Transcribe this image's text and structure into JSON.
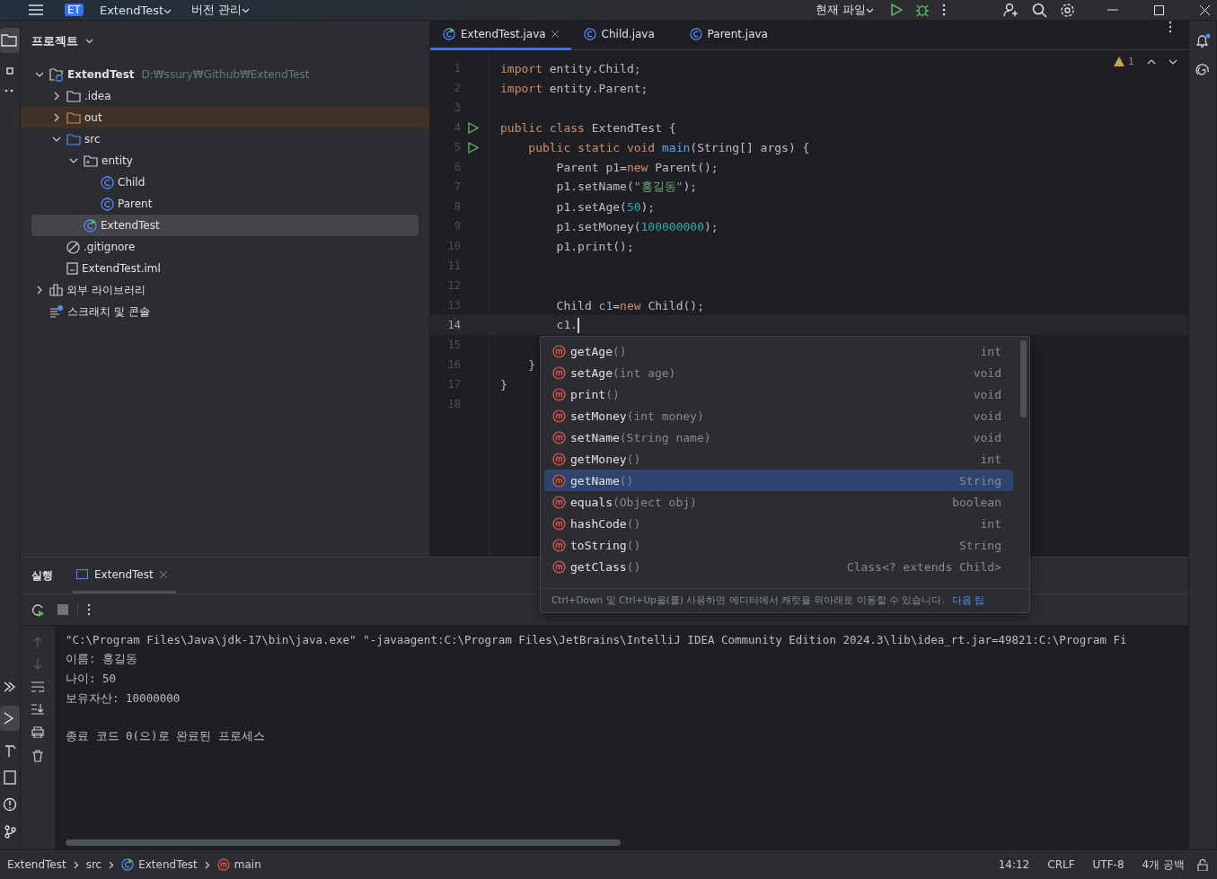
{
  "title_bar": {
    "project_badge": "ET",
    "project": "ExtendTest",
    "vcs": "버전 관리",
    "run_config": "현재 파일"
  },
  "project_panel": {
    "title": "프로젝트",
    "tree": [
      {
        "label": "ExtendTest",
        "path": "D:₩ssury₩Github₩ExtendTest",
        "kind": "project",
        "expanded": true,
        "selected": false,
        "children": [
          {
            "label": ".idea",
            "kind": "folder",
            "expanded": false,
            "selected": false
          },
          {
            "label": "out",
            "kind": "excluded",
            "expanded": false,
            "selected": false
          },
          {
            "label": "src",
            "kind": "source",
            "expanded": true,
            "selected": false,
            "children": [
              {
                "label": "entity",
                "kind": "package",
                "expanded": true,
                "selected": false,
                "children": [
                  {
                    "label": "Child",
                    "kind": "class",
                    "selected": false
                  },
                  {
                    "label": "Parent",
                    "kind": "class",
                    "selected": false
                  }
                ]
              },
              {
                "label": "ExtendTest",
                "kind": "main-class",
                "selected": true
              }
            ]
          },
          {
            "label": ".gitignore",
            "kind": "ignore",
            "selected": false
          },
          {
            "label": "ExtendTest.iml",
            "kind": "module-file",
            "selected": false
          }
        ]
      },
      {
        "label": "외부 라이브러리",
        "kind": "library",
        "expanded": false,
        "selected": false
      },
      {
        "label": "스크래치 및 콘솔",
        "kind": "scratch",
        "selected": false
      }
    ]
  },
  "editor": {
    "tabs": [
      {
        "label": "ExtendTest.java",
        "kind": "main-class",
        "selected": true,
        "closable": true
      },
      {
        "label": "Child.java",
        "kind": "class",
        "selected": false,
        "closable": false
      },
      {
        "label": "Parent.java",
        "kind": "class",
        "selected": false,
        "closable": false
      }
    ],
    "warnings": "1",
    "lines": [
      {
        "no": "1",
        "run": false,
        "current": false,
        "tokens": [
          {
            "t": "import ",
            "kind": "keyword"
          },
          {
            "t": "entity.Child;",
            "kind": "plain"
          }
        ]
      },
      {
        "no": "2",
        "run": false,
        "current": false,
        "tokens": [
          {
            "t": "import ",
            "kind": "keyword"
          },
          {
            "t": "entity.Parent;",
            "kind": "plain"
          }
        ]
      },
      {
        "no": "3",
        "run": false,
        "current": false
      },
      {
        "no": "4",
        "run": true,
        "current": false,
        "tokens": [
          {
            "t": "public class ",
            "kind": "keyword"
          },
          {
            "t": "ExtendTest {",
            "kind": "plain"
          }
        ]
      },
      {
        "no": "5",
        "run": true,
        "current": false,
        "tokens": [
          {
            "t": "    public static void ",
            "kind": "keyword"
          },
          {
            "t": "main",
            "kind": "function"
          },
          {
            "t": "(String[] args) {",
            "kind": "plain"
          }
        ]
      },
      {
        "no": "6",
        "run": false,
        "current": false,
        "tokens": [
          {
            "t": "        Parent p1=",
            "kind": "plain"
          },
          {
            "t": "new ",
            "kind": "keyword"
          },
          {
            "t": "Parent();",
            "kind": "plain"
          }
        ]
      },
      {
        "no": "7",
        "run": false,
        "current": false,
        "tokens": [
          {
            "t": "        p1.setName(",
            "kind": "plain"
          },
          {
            "t": "\"홍길동\"",
            "kind": "string"
          },
          {
            "t": ");",
            "kind": "plain"
          }
        ]
      },
      {
        "no": "8",
        "run": false,
        "current": false,
        "tokens": [
          {
            "t": "        p1.setAge(",
            "kind": "plain"
          },
          {
            "t": "50",
            "kind": "number"
          },
          {
            "t": ");",
            "kind": "plain"
          }
        ]
      },
      {
        "no": "9",
        "run": false,
        "current": false,
        "tokens": [
          {
            "t": "        p1.setMoney(",
            "kind": "plain"
          },
          {
            "t": "100000000",
            "kind": "number"
          },
          {
            "t": ");",
            "kind": "plain"
          }
        ]
      },
      {
        "no": "10",
        "run": false,
        "current": false,
        "tokens": [
          {
            "t": "        p1.print();",
            "kind": "plain"
          }
        ]
      },
      {
        "no": "11",
        "run": false,
        "current": false
      },
      {
        "no": "12",
        "run": false,
        "current": false
      },
      {
        "no": "13",
        "run": false,
        "current": false,
        "tokens": [
          {
            "t": "        Child ",
            "kind": "plain"
          },
          {
            "t": "c1",
            "kind": "variable"
          },
          {
            "t": "=",
            "kind": "plain"
          },
          {
            "t": "new ",
            "kind": "keyword"
          },
          {
            "t": "Child();",
            "kind": "plain"
          }
        ]
      },
      {
        "no": "14",
        "run": false,
        "current": true,
        "tokens": [
          {
            "t": "        c1.",
            "kind": "plain"
          }
        ]
      },
      {
        "no": "15",
        "run": false,
        "current": false
      },
      {
        "no": "16",
        "run": false,
        "current": false,
        "tokens": [
          {
            "t": "    }",
            "kind": "plain"
          }
        ]
      },
      {
        "no": "17",
        "run": false,
        "current": false,
        "tokens": [
          {
            "t": "}",
            "kind": "plain"
          }
        ]
      },
      {
        "no": "18",
        "run": false,
        "current": false
      }
    ]
  },
  "completion": {
    "items": [
      {
        "name": "getAge",
        "params": "()",
        "type": "int",
        "selected": false
      },
      {
        "name": "setAge",
        "params": "(int age)",
        "type": "void",
        "selected": false
      },
      {
        "name": "print",
        "params": "()",
        "type": "void",
        "selected": false
      },
      {
        "name": "setMoney",
        "params": "(int money)",
        "type": "void",
        "selected": false
      },
      {
        "name": "setName",
        "params": "(String name)",
        "type": "void",
        "selected": false
      },
      {
        "name": "getMoney",
        "params": "()",
        "type": "int",
        "selected": false
      },
      {
        "name": "getName",
        "params": "()",
        "type": "String",
        "selected": true
      },
      {
        "name": "equals",
        "params": "(Object obj)",
        "type": "boolean",
        "selected": false
      },
      {
        "name": "hashCode",
        "params": "()",
        "type": "int",
        "selected": false
      },
      {
        "name": "toString",
        "params": "()",
        "type": "String",
        "selected": false
      },
      {
        "name": "getClass",
        "params": "()",
        "type": "Class<? extends Child>",
        "selected": false
      }
    ],
    "hint": "Ctrl+Down 및 Ctrl+Up을(를) 사용하면 에디터에서 캐럿을 위아래로 이동할 수 있습니다.",
    "hint_link": "다음 팁"
  },
  "run_panel": {
    "title": "실행",
    "tab": "ExtendTest",
    "console": [
      {
        "text": "\"C:\\Program Files\\Java\\jdk-17\\bin\\java.exe\" \"-javaagent:C:\\Program Files\\JetBrains\\IntelliJ IDEA Community Edition 2024.3\\lib\\idea_rt.jar=49821:C:\\Program Fi",
        "blank_before": false
      },
      {
        "text": "이름: 홍길동",
        "blank_before": false
      },
      {
        "text": "나이: 50",
        "blank_before": false
      },
      {
        "text": "보유자산: 10000000",
        "blank_before": false
      },
      {
        "text": "종료 코드 0(으)로 완료된 프로세스",
        "blank_before": true
      }
    ]
  },
  "status_bar": {
    "breadcrumbs": [
      {
        "label": "ExtendTest",
        "kind": "module"
      },
      {
        "label": "src",
        "kind": "folder"
      },
      {
        "label": "ExtendTest",
        "kind": "main-class"
      },
      {
        "label": "main",
        "kind": "method"
      }
    ],
    "position": "14:12",
    "line_separator": "CRLF",
    "encoding": "UTF-8",
    "indent": "4개 공백"
  }
}
